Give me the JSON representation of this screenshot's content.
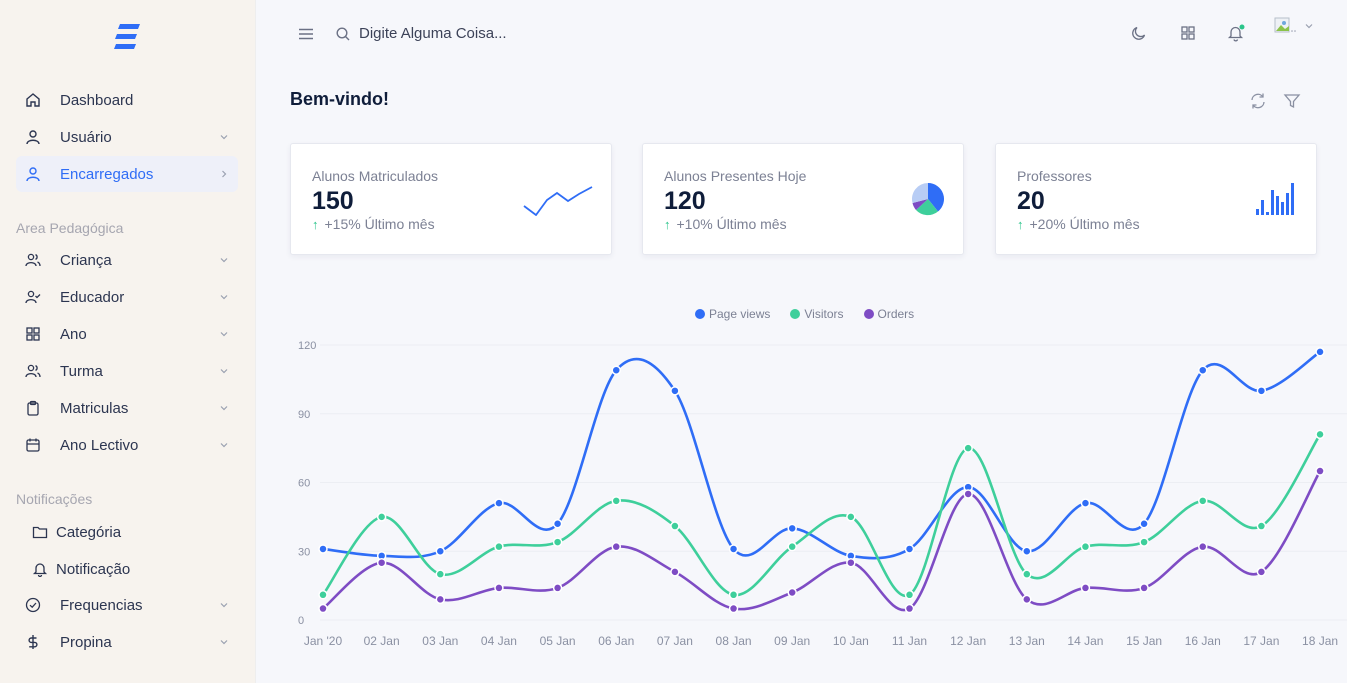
{
  "sidebar": {
    "items": [
      {
        "label": "Dashboard",
        "icon": "home-icon"
      },
      {
        "label": "Usuário",
        "icon": "user-icon"
      },
      {
        "label": "Encarregados",
        "icon": "user-icon"
      }
    ],
    "pedagogica_title": "Area Pedagógica",
    "pedagogica_items": [
      {
        "label": "Criança",
        "icon": "users-icon"
      },
      {
        "label": "Educador",
        "icon": "user-check-icon"
      },
      {
        "label": "Ano",
        "icon": "grid-icon"
      },
      {
        "label": "Turma",
        "icon": "users-icon"
      },
      {
        "label": "Matriculas",
        "icon": "clipboard-icon"
      },
      {
        "label": "Ano Lectivo",
        "icon": "calendar-icon"
      }
    ],
    "notif_title": "Notificações",
    "notif_sub": [
      {
        "label": "Categória",
        "icon": "folder-icon"
      },
      {
        "label": "Notificação",
        "icon": "bell-icon"
      }
    ],
    "bottom_items": [
      {
        "label": "Frequencias",
        "icon": "check-circle-icon"
      },
      {
        "label": "Propina",
        "icon": "dollar-icon"
      }
    ]
  },
  "topbar": {
    "search_placeholder": "Digite Alguma Coisa..."
  },
  "page": {
    "title": "Bem-vindo!"
  },
  "cards": [
    {
      "label": "Alunos Matriculados",
      "value": "150",
      "delta": "+15% Último mês"
    },
    {
      "label": "Alunos Presentes Hoje",
      "value": "120",
      "delta": "+10% Último mês"
    },
    {
      "label": "Professores",
      "value": "20",
      "delta": "+20% Último mês"
    }
  ],
  "colors": {
    "accent": "#2f6df6",
    "page_views": "#2f6df6",
    "visitors": "#3ecf9b",
    "orders": "#7e4cc4",
    "positive": "#2bc48a"
  },
  "chart_data": {
    "type": "line",
    "categories": [
      "Jan '20",
      "02 Jan",
      "03 Jan",
      "04 Jan",
      "05 Jan",
      "06 Jan",
      "07 Jan",
      "08 Jan",
      "09 Jan",
      "10 Jan",
      "11 Jan",
      "12 Jan",
      "13 Jan",
      "14 Jan",
      "15 Jan",
      "16 Jan",
      "17 Jan",
      "18 Jan"
    ],
    "series": [
      {
        "name": "Page views",
        "values": [
          31,
          28,
          30,
          51,
          42,
          109,
          100,
          31,
          40,
          28,
          31,
          58,
          30,
          51,
          42,
          109,
          100,
          117
        ]
      },
      {
        "name": "Visitors",
        "values": [
          11,
          45,
          20,
          32,
          34,
          52,
          41,
          11,
          32,
          45,
          11,
          75,
          20,
          32,
          34,
          52,
          41,
          81
        ]
      },
      {
        "name": "Orders",
        "values": [
          5,
          25,
          9,
          14,
          14,
          32,
          21,
          5,
          12,
          25,
          5,
          55,
          9,
          14,
          14,
          32,
          21,
          65
        ]
      }
    ],
    "yticks": [
      0,
      30,
      60,
      90,
      120
    ],
    "ylim": [
      0,
      120
    ],
    "grid": true,
    "legend": "top-center"
  }
}
